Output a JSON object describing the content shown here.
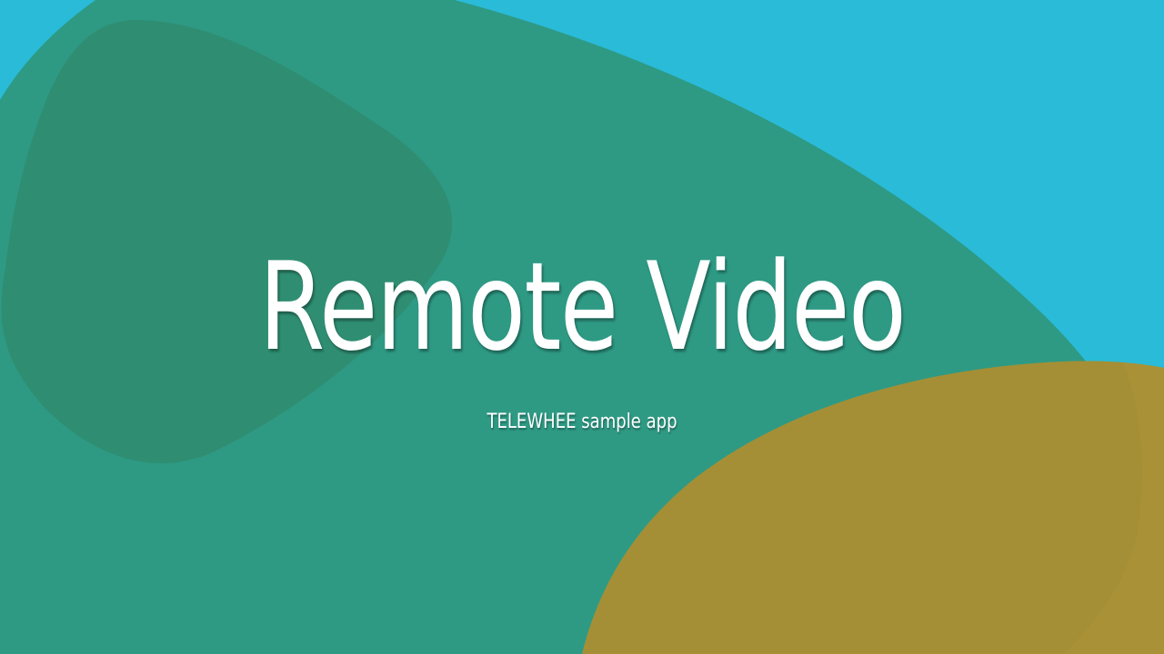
{
  "splash": {
    "title": "Remote Video",
    "subtitle": "TELEWHEE sample app"
  },
  "colors": {
    "background": "#29BBD8",
    "teal_shape": "#2E9A84",
    "dark_teal_shape": "#2F8E72",
    "gold_shape": "#A99137",
    "text": "#FFFFFF"
  }
}
